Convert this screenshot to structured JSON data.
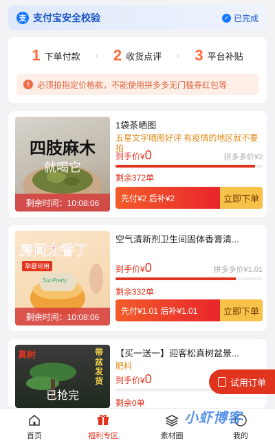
{
  "verify": {
    "title": "支付宝安全校验",
    "status": "已完成",
    "logo_text": "支"
  },
  "steps": [
    {
      "num": "1",
      "label": "下单付款"
    },
    {
      "num": "2",
      "label": "收货点评"
    },
    {
      "num": "3",
      "label": "平台补贴"
    }
  ],
  "notice": "必须拍指定价格款，不能使用拼多多无门槛券红包等",
  "products": [
    {
      "name": "1袋茶晒图",
      "desc": "五星文字晒图好评 有疫情的地区就不要拍",
      "hand_label": "到手价¥",
      "hand_price": "0",
      "pdd_price": "拼多多价¥2",
      "progress": 0.95,
      "stock": "剩余372单",
      "rebate": "先付¥2 后补¥2",
      "buy_label": "立即下单",
      "img_title": "四肢麻木",
      "img_sub": "就喝它",
      "caption": "剩余时间：10:08:06"
    },
    {
      "name": "空气清新剂卫生间固体香膏清...",
      "desc": "",
      "hand_label": "到手价¥",
      "hand_price": "0",
      "pdd_price": "拼多多价¥1.01",
      "progress": 0.82,
      "stock": "剩余332单",
      "rebate": "先付¥1.01 后补¥1.01",
      "buy_label": "立即下单",
      "img_title": "房间太香了",
      "img_badge": "孕婴可用",
      "img_brand": "SunPretty",
      "caption": "剩余时间：10:08:06"
    },
    {
      "name": "【买一送一】迎客松真树盆景...",
      "desc": "肥料",
      "hand_label": "到手价¥",
      "hand_price": "0",
      "progress": 0,
      "stock": "剩余0单",
      "img_tag": "真树",
      "img_side": "带盆发货",
      "sold_out": "已抢完"
    }
  ],
  "float_button": "试用订单",
  "watermark": "小虾博客",
  "tabs": [
    {
      "label": "首页",
      "icon": "home-icon",
      "active": false
    },
    {
      "label": "福利专区",
      "icon": "gift-icon",
      "active": true
    },
    {
      "label": "素材圈",
      "icon": "layers-icon",
      "active": false
    },
    {
      "label": "我的",
      "icon": "profile-icon",
      "active": false
    }
  ],
  "colors": {
    "accent": "#e0341f",
    "alipay_blue": "#1677ff",
    "step_orange": "#ff6a3d",
    "buy_yellow": "#f7c14a"
  }
}
